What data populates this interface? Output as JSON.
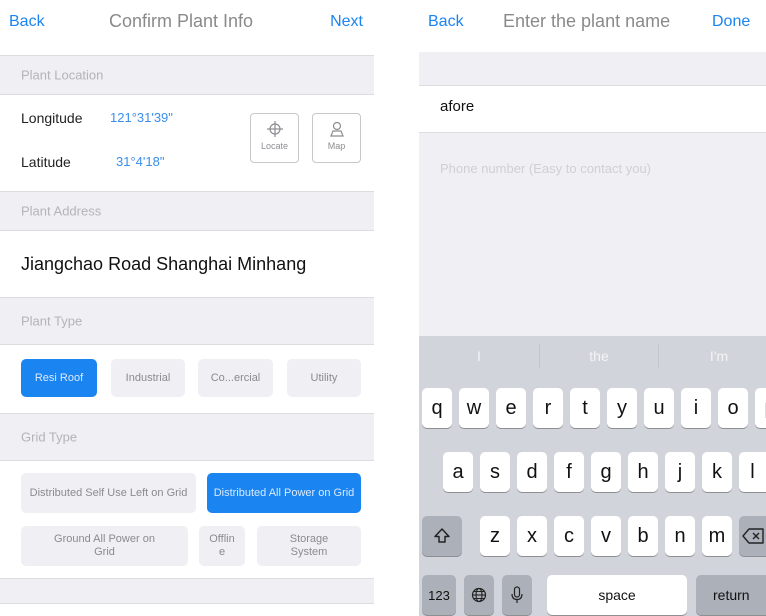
{
  "left": {
    "nav": {
      "back": "Back",
      "title": "Confirm Plant Info",
      "next": "Next"
    },
    "location": {
      "header": "Plant Location",
      "longitude_label": "Longitude",
      "longitude_value": "121°31'39\"",
      "latitude_label": "Latitude",
      "latitude_value": "31°4'18\"",
      "locate_label": "Locate",
      "map_label": "Map"
    },
    "address": {
      "header": "Plant Address",
      "value": "Jiangchao Road Shanghai Minhang"
    },
    "plant_type": {
      "header": "Plant Type",
      "options": [
        "Resi Roof",
        "Industrial",
        "Co...ercial",
        "Utility"
      ],
      "selected": "Resi Roof"
    },
    "grid_type": {
      "header": "Grid Type",
      "options": [
        "Distributed Self Use Left on Grid",
        "Distributed All Power on Grid",
        "Ground All Power on Grid",
        "Offlin e",
        "Storage System"
      ],
      "selected": "Distributed All Power on Grid"
    }
  },
  "right": {
    "nav": {
      "back": "Back",
      "title": "Enter the plant name",
      "done": "Done"
    },
    "name_value": "afore",
    "phone_placeholder": "Phone number (Easy to contact you)",
    "keyboard": {
      "suggestions": [
        "I",
        "the",
        "I'm"
      ],
      "row1": [
        "q",
        "w",
        "e",
        "r",
        "t",
        "y",
        "u",
        "i",
        "o",
        "p"
      ],
      "row2": [
        "a",
        "s",
        "d",
        "f",
        "g",
        "h",
        "j",
        "k",
        "l"
      ],
      "row3": [
        "z",
        "x",
        "c",
        "v",
        "b",
        "n",
        "m"
      ],
      "numbers_label": "123",
      "space_label": "space",
      "return_label": "return"
    }
  },
  "colors": {
    "accent": "#1a84f0",
    "section_bg": "#efeff4",
    "keyboard_bg": "#d1d4da"
  }
}
